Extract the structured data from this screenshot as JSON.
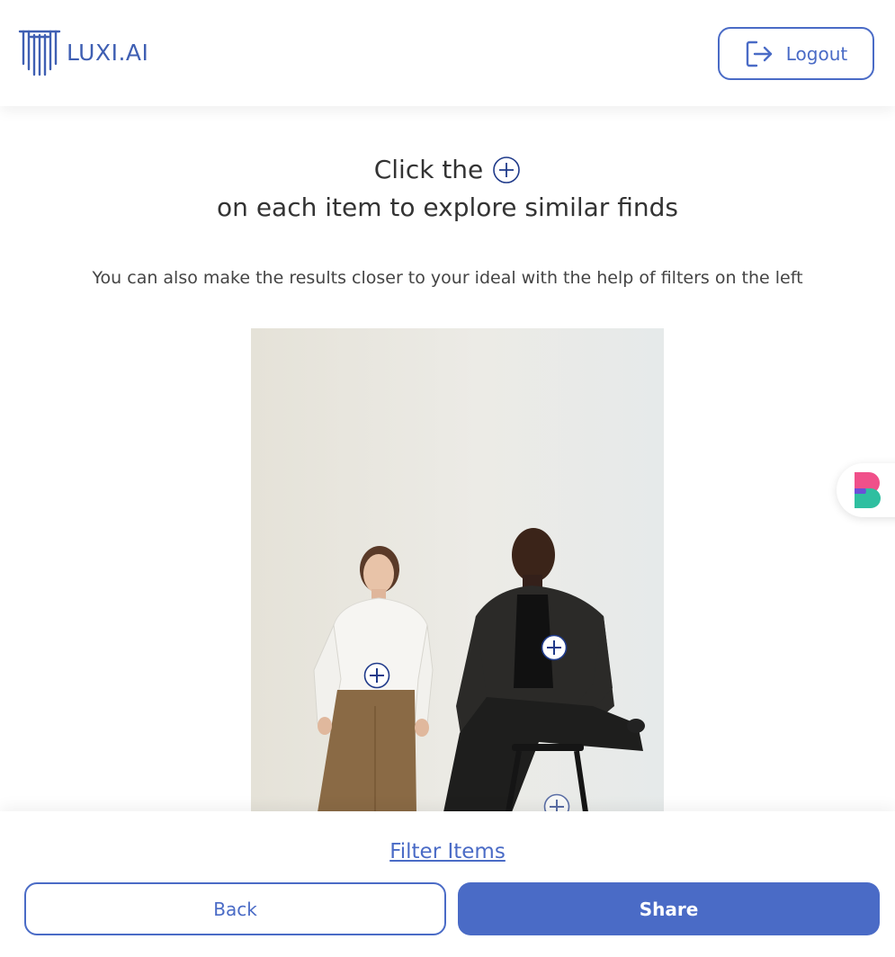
{
  "header": {
    "logo_text": "LUXI.AI",
    "logout_label": "Logout"
  },
  "headline": {
    "line1": "Click the",
    "line2": "on each item to explore similar finds"
  },
  "subtext": "You can also make the results closer to your ideal with the help of filters on the left",
  "icons": {
    "logo": "luxi-logo-icon",
    "logout": "logout-icon",
    "hotspot": "plus-circle-icon",
    "side_widget": "app-badge-icon"
  },
  "colors": {
    "accent": "#4a6bc6",
    "hotspot": "#1f3a8a",
    "text": "#333333"
  },
  "footer": {
    "filter_label": "Filter Items",
    "back_label": "Back",
    "share_label": "Share"
  }
}
